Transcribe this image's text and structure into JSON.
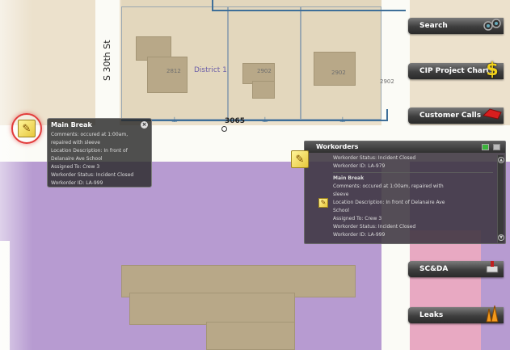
{
  "map": {
    "street_label": "S 30th St",
    "district_label": "District 1",
    "address_main": "3065",
    "parcel_numbers": [
      "2812",
      "2902",
      "2902",
      "2902"
    ]
  },
  "tools": [
    {
      "label": "Search",
      "icon": "search-binoculars-icon"
    },
    {
      "label": "CIP Project Charts",
      "icon": "dollar-sign-icon"
    },
    {
      "label": "Customer Calls",
      "icon": "phone-icon"
    },
    {
      "label": "SC&DA",
      "icon": "pipe-valve-icon"
    },
    {
      "label": "Leaks",
      "icon": "leak-icon"
    }
  ],
  "popup": {
    "title": "Main Break",
    "lines": [
      "Comments: occured at 1:00am,",
      "repaired with sleeve",
      "Location Description: In front of",
      "Delanaire Ave School",
      "Assigned To: Crew 3",
      "Workorder Status: Incident Closed",
      "Workorder ID: LA-999"
    ]
  },
  "workorders": {
    "title": "Workorders",
    "item1": {
      "lines": [
        "Workorder Status: Incident Closed",
        "Workorder ID: LA-979"
      ]
    },
    "item2": {
      "title": "Main Break",
      "lines": [
        "Comments: occured at 1:00am, repaired with",
        "sleeve",
        "Location Description: In front of Delanaire Ave",
        "School",
        "Assigned To: Crew 3",
        "Workorder Status: Incident Closed",
        "Workorder ID: LA-999"
      ]
    }
  },
  "colors": {
    "background_land": "#ece1cc",
    "zone_purple": "#b79bd1",
    "zone_pink": "#e8a9c2",
    "pipe_blue": "#3e6f99",
    "selection_red": "#e23b3b"
  }
}
